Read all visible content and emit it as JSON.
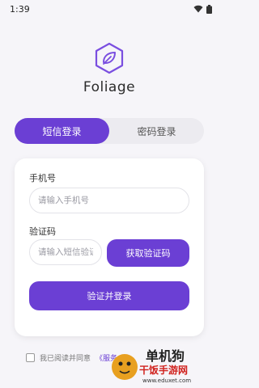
{
  "status_bar": {
    "time": "1:39"
  },
  "app": {
    "name": "Foliage"
  },
  "tabs": [
    {
      "label": "短信登录",
      "active": true
    },
    {
      "label": "密码登录",
      "active": false
    }
  ],
  "form": {
    "phone_label": "手机号",
    "phone_placeholder": "请输入手机号",
    "code_label": "验证码",
    "code_placeholder": "请输入短信验证码",
    "get_code_button": "获取验证码",
    "submit_button": "验证并登录"
  },
  "agreement": {
    "checked": false,
    "text": "我已阅读并同意",
    "link": "《服务"
  },
  "watermark": {
    "line1": "单机狗",
    "line2": "干饭手游网",
    "url": "www.eduxet.com"
  },
  "colors": {
    "accent": "#6b3fd4",
    "background": "#f6f5f9"
  }
}
